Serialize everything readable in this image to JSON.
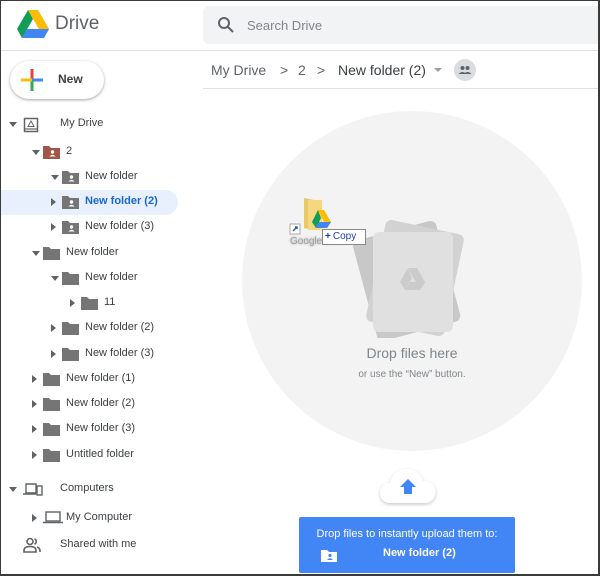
{
  "app": {
    "brand": "Drive",
    "search_placeholder": "Search Drive"
  },
  "new_button": {
    "label": "New"
  },
  "sidebar": {
    "tree": [
      {
        "label": "My Drive",
        "icon": "my-drive-icon",
        "expanded": true,
        "level": 0
      },
      {
        "label": "2",
        "icon": "shared-folder-icon",
        "expanded": true,
        "level": 1,
        "color": "#a1564a"
      },
      {
        "label": "New folder",
        "icon": "shared-folder-icon",
        "expanded": true,
        "level": 2
      },
      {
        "label": "New folder (2)",
        "icon": "shared-folder-icon",
        "expanded": false,
        "level": 2,
        "selected": true
      },
      {
        "label": "New folder (3)",
        "icon": "shared-folder-icon",
        "expanded": false,
        "level": 2
      },
      {
        "label": "New folder",
        "icon": "folder-icon",
        "expanded": true,
        "level": 1
      },
      {
        "label": "New folder",
        "icon": "folder-icon",
        "expanded": true,
        "level": 2
      },
      {
        "label": "11",
        "icon": "folder-icon",
        "expanded": false,
        "level": 3
      },
      {
        "label": "New folder (2)",
        "icon": "folder-icon",
        "expanded": false,
        "level": 2
      },
      {
        "label": "New folder (3)",
        "icon": "folder-icon",
        "expanded": false,
        "level": 2
      },
      {
        "label": "New folder (1)",
        "icon": "folder-icon",
        "expanded": false,
        "level": 1
      },
      {
        "label": "New folder (2)",
        "icon": "folder-icon",
        "expanded": false,
        "level": 1
      },
      {
        "label": "New folder (3)",
        "icon": "folder-icon",
        "expanded": false,
        "level": 1
      },
      {
        "label": "Untitled folder",
        "icon": "folder-icon",
        "expanded": false,
        "level": 1
      },
      {
        "label": "Computers",
        "icon": "computers-icon",
        "expanded": true,
        "level": 0
      },
      {
        "label": "My Computer",
        "icon": "laptop-icon",
        "expanded": false,
        "level": 1
      },
      {
        "label": "Shared with me",
        "icon": "shared-with-me-icon",
        "level": 0
      }
    ]
  },
  "breadcrumb": {
    "items": [
      "My Drive",
      "2",
      "New folder (2)"
    ],
    "separator": ">"
  },
  "dropzone": {
    "title": "Drop files here",
    "subtitle": "or use the “New” button."
  },
  "drag": {
    "item_label": "Google Drive",
    "copy_label": "Copy",
    "copy_symbol": "+"
  },
  "toast": {
    "line1": "Drop files to instantly upload them to:",
    "folder": "New folder (2)"
  },
  "colors": {
    "accent": "#4285f4",
    "selected_bg": "#e8f0fe",
    "selected_text": "#1967d2"
  }
}
